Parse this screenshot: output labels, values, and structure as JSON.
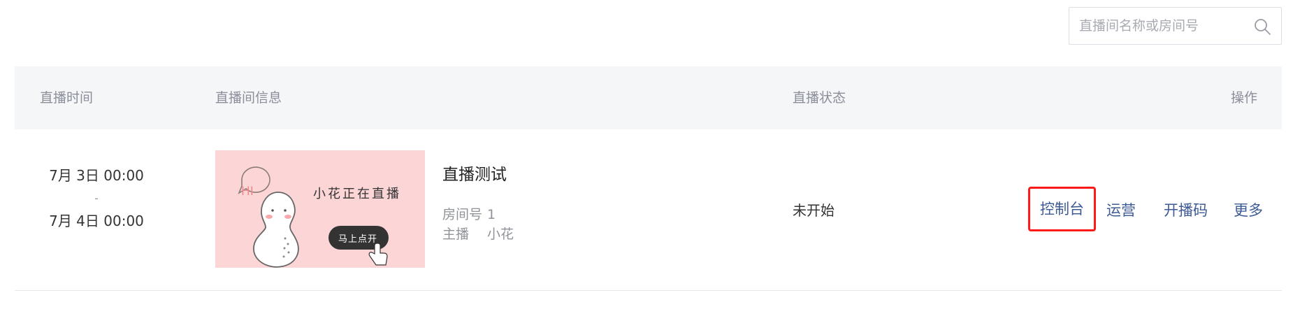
{
  "search": {
    "placeholder": "直播间名称或房间号",
    "icon": "search-icon"
  },
  "table": {
    "headers": {
      "time": "直播时间",
      "info": "直播间信息",
      "status": "直播状态",
      "actions": "操作"
    },
    "rows": [
      {
        "start": "7月 3日 00:00",
        "separator": "-",
        "end": "7月 4日 00:00",
        "thumbnail": {
          "bubble_text": "HI",
          "headline": "小花正在直播",
          "button_text": "马上点开",
          "background": "#fcd5d7"
        },
        "title": "直播测试",
        "room_label": "房间号",
        "room_value": "1",
        "host_label": "主播",
        "host_value": "小花",
        "status": "未开始",
        "actions": [
          "控制台",
          "运营",
          "开播码",
          "更多"
        ]
      }
    ]
  },
  "colors": {
    "link": "#3d5a96",
    "highlight_border": "#ff1a1a",
    "header_bg": "#f5f6f8"
  }
}
